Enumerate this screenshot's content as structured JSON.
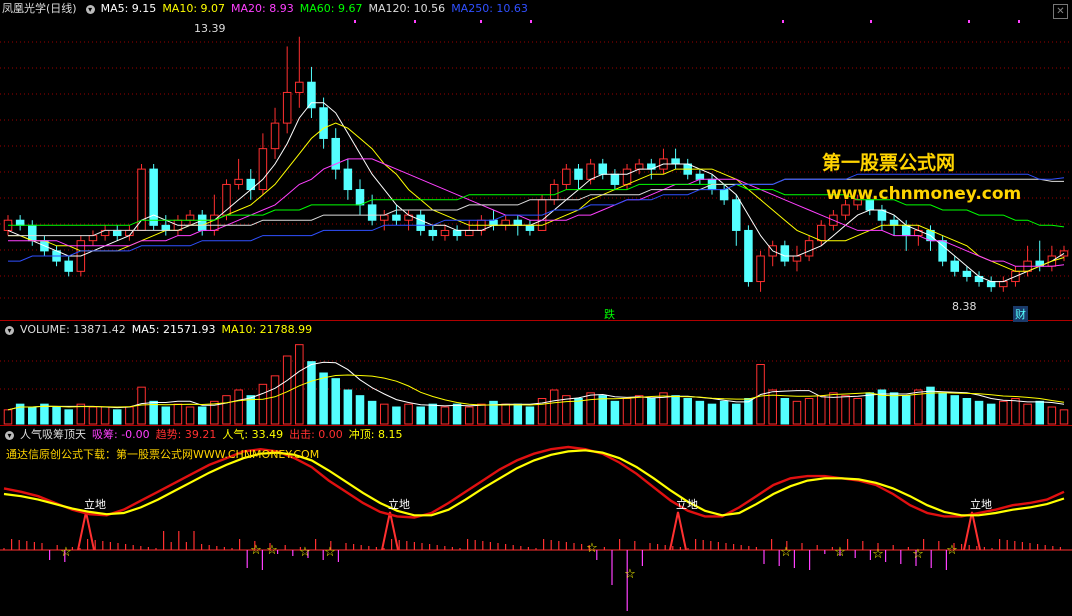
{
  "main": {
    "title": "凤凰光学(日线)",
    "ma": [
      {
        "label": "MA5: 9.15",
        "color": "#ffffff"
      },
      {
        "label": "MA10: 9.07",
        "color": "#ffff00"
      },
      {
        "label": "MA20: 8.93",
        "color": "#ff40ff"
      },
      {
        "label": "MA60: 9.67",
        "color": "#00ff00"
      },
      {
        "label": "MA120: 10.56",
        "color": "#dddddd"
      },
      {
        "label": "MA250: 10.63",
        "color": "#3050ff"
      }
    ],
    "high_label": "13.39",
    "low_label": "8.38",
    "event_die": "跌",
    "event_cai": "财"
  },
  "watermark": {
    "line1": "第一股票公式网",
    "line2": "www.chnmoney.com"
  },
  "volume": {
    "title": "VOLUME: 13871.42",
    "ma5": "MA5: 21571.93",
    "ma10": "MA10: 21788.99"
  },
  "indicator": {
    "title": "人气吸筹顶天",
    "xichou": "吸筹: -0.00",
    "qushi": "趋势: 39.21",
    "renqi": "人气: 33.49",
    "chuji": "出击: 0.00",
    "chongding": "冲顶: 8.15",
    "note": "通达信原创公式下载：第一股票公式网WWW.CHNMONEY.COM",
    "signal": "立地"
  },
  "colors": {
    "up": "#ff3030",
    "down": "#54ffff",
    "grid": "#9a0000"
  },
  "chart_data": {
    "type": "candlestick",
    "title": "凤凰光学(日线)",
    "y_range": [
      8.38,
      13.39
    ],
    "candles": [
      [
        9.6,
        9.8,
        9.9,
        9.5
      ],
      [
        9.8,
        9.7,
        9.9,
        9.6
      ],
      [
        9.7,
        9.4,
        9.8,
        9.3
      ],
      [
        9.4,
        9.2,
        9.5,
        9.1
      ],
      [
        9.2,
        9.0,
        9.3,
        8.9
      ],
      [
        9.0,
        8.8,
        9.1,
        8.7
      ],
      [
        8.8,
        9.4,
        9.5,
        8.7
      ],
      [
        9.4,
        9.5,
        9.6,
        9.3
      ],
      [
        9.5,
        9.6,
        9.7,
        9.4
      ],
      [
        9.6,
        9.5,
        9.7,
        9.4
      ],
      [
        9.5,
        9.6,
        9.7,
        9.4
      ],
      [
        9.6,
        10.8,
        10.9,
        9.6
      ],
      [
        10.8,
        9.7,
        10.9,
        9.6
      ],
      [
        9.7,
        9.6,
        9.9,
        9.5
      ],
      [
        9.6,
        9.8,
        9.9,
        9.5
      ],
      [
        9.8,
        9.9,
        10.0,
        9.7
      ],
      [
        9.9,
        9.6,
        10.0,
        9.5
      ],
      [
        9.6,
        9.9,
        10.3,
        9.5
      ],
      [
        9.9,
        10.5,
        10.6,
        9.8
      ],
      [
        10.5,
        10.6,
        11.0,
        10.4
      ],
      [
        10.6,
        10.4,
        10.8,
        10.2
      ],
      [
        10.4,
        11.2,
        11.5,
        10.3
      ],
      [
        11.2,
        11.7,
        12.0,
        11.0
      ],
      [
        11.7,
        12.3,
        13.2,
        11.5
      ],
      [
        12.3,
        12.5,
        13.39,
        12.0
      ],
      [
        12.5,
        12.0,
        12.8,
        11.8
      ],
      [
        12.0,
        11.4,
        12.2,
        11.2
      ],
      [
        11.4,
        10.8,
        11.6,
        10.6
      ],
      [
        10.8,
        10.4,
        11.0,
        10.2
      ],
      [
        10.4,
        10.1,
        10.6,
        9.9
      ],
      [
        10.1,
        9.8,
        10.3,
        9.7
      ],
      [
        9.8,
        9.9,
        10.0,
        9.6
      ],
      [
        9.9,
        9.8,
        10.1,
        9.7
      ],
      [
        9.8,
        9.9,
        10.0,
        9.6
      ],
      [
        9.9,
        9.6,
        10.0,
        9.5
      ],
      [
        9.6,
        9.5,
        9.7,
        9.4
      ],
      [
        9.5,
        9.6,
        9.7,
        9.4
      ],
      [
        9.6,
        9.5,
        9.7,
        9.4
      ],
      [
        9.5,
        9.6,
        9.8,
        9.5
      ],
      [
        9.6,
        9.8,
        9.9,
        9.5
      ],
      [
        9.8,
        9.7,
        10.0,
        9.6
      ],
      [
        9.7,
        9.8,
        9.9,
        9.6
      ],
      [
        9.8,
        9.7,
        9.9,
        9.5
      ],
      [
        9.7,
        9.6,
        9.8,
        9.5
      ],
      [
        9.6,
        10.2,
        10.3,
        9.6
      ],
      [
        10.2,
        10.5,
        10.6,
        10.1
      ],
      [
        10.5,
        10.8,
        10.9,
        10.4
      ],
      [
        10.8,
        10.6,
        10.9,
        10.4
      ],
      [
        10.6,
        10.9,
        11.0,
        10.5
      ],
      [
        10.9,
        10.7,
        11.0,
        10.6
      ],
      [
        10.7,
        10.5,
        10.8,
        10.4
      ],
      [
        10.5,
        10.8,
        10.9,
        10.4
      ],
      [
        10.8,
        10.9,
        11.0,
        10.7
      ],
      [
        10.9,
        10.8,
        11.0,
        10.6
      ],
      [
        10.8,
        11.0,
        11.2,
        10.7
      ],
      [
        11.0,
        10.9,
        11.2,
        10.8
      ],
      [
        10.9,
        10.7,
        11.0,
        10.6
      ],
      [
        10.7,
        10.6,
        10.8,
        10.5
      ],
      [
        10.6,
        10.4,
        10.7,
        10.3
      ],
      [
        10.4,
        10.2,
        10.5,
        10.1
      ],
      [
        10.2,
        9.6,
        10.3,
        9.3
      ],
      [
        9.6,
        8.6,
        9.7,
        8.5
      ],
      [
        8.6,
        9.1,
        9.2,
        8.4
      ],
      [
        9.1,
        9.3,
        9.4,
        8.9
      ],
      [
        9.3,
        9.0,
        9.4,
        8.9
      ],
      [
        9.0,
        9.1,
        9.3,
        8.8
      ],
      [
        9.1,
        9.4,
        9.5,
        9.0
      ],
      [
        9.4,
        9.7,
        9.8,
        9.3
      ],
      [
        9.7,
        9.9,
        10.0,
        9.6
      ],
      [
        9.9,
        10.1,
        10.2,
        9.8
      ],
      [
        10.1,
        10.2,
        10.3,
        10.0
      ],
      [
        10.2,
        10.0,
        10.3,
        9.9
      ],
      [
        10.0,
        9.8,
        10.1,
        9.6
      ],
      [
        9.8,
        9.7,
        9.9,
        9.5
      ],
      [
        9.7,
        9.5,
        9.8,
        9.2
      ],
      [
        9.5,
        9.6,
        9.7,
        9.3
      ],
      [
        9.6,
        9.4,
        9.7,
        9.2
      ],
      [
        9.4,
        9.0,
        9.5,
        8.9
      ],
      [
        9.0,
        8.8,
        9.1,
        8.7
      ],
      [
        8.8,
        8.7,
        8.9,
        8.6
      ],
      [
        8.7,
        8.6,
        8.8,
        8.5
      ],
      [
        8.6,
        8.5,
        8.7,
        8.4
      ],
      [
        8.5,
        8.6,
        8.7,
        8.4
      ],
      [
        8.6,
        8.8,
        8.9,
        8.5
      ],
      [
        8.8,
        9.0,
        9.3,
        8.7
      ],
      [
        9.0,
        8.9,
        9.4,
        8.8
      ],
      [
        8.9,
        9.1,
        9.3,
        8.8
      ],
      [
        9.1,
        9.2,
        9.3,
        9.0
      ]
    ],
    "volume": [
      5,
      7,
      6,
      7,
      6,
      5,
      7,
      6,
      6,
      5,
      6,
      13,
      8,
      6,
      7,
      6,
      6,
      8,
      10,
      12,
      10,
      14,
      17,
      24,
      28,
      22,
      18,
      16,
      12,
      10,
      8,
      7,
      6,
      7,
      6,
      7,
      6,
      7,
      6,
      7,
      8,
      7,
      7,
      6,
      9,
      12,
      10,
      9,
      11,
      10,
      8,
      9,
      10,
      9,
      11,
      10,
      9,
      8,
      7,
      8,
      7,
      9,
      21,
      12,
      9,
      8,
      9,
      10,
      11,
      10,
      9,
      11,
      12,
      11,
      10,
      12,
      13,
      11,
      10,
      9,
      8,
      7,
      8,
      9,
      7,
      8,
      6,
      5
    ],
    "series": [
      {
        "name": "MA5",
        "values": [
          9.6,
          9.5,
          9.4,
          9.3,
          9.2,
          9.1,
          9.1,
          9.2,
          9.3,
          9.4,
          9.5,
          9.8,
          9.9,
          9.8,
          9.7,
          9.7,
          9.8,
          9.8,
          10.0,
          10.2,
          10.4,
          10.6,
          10.9,
          11.3,
          11.8,
          12.1,
          12.1,
          11.9,
          11.5,
          11.1,
          10.7,
          10.4,
          10.1,
          9.9,
          9.8,
          9.7,
          9.7,
          9.6,
          9.6,
          9.6,
          9.7,
          9.7,
          9.7,
          9.7,
          9.8,
          10.0,
          10.2,
          10.4,
          10.6,
          10.7,
          10.7,
          10.7,
          10.8,
          10.8,
          10.9,
          10.9,
          10.9,
          10.8,
          10.7,
          10.5,
          10.3,
          9.9,
          9.5,
          9.2,
          9.1,
          9.1,
          9.2,
          9.3,
          9.5,
          9.7,
          9.9,
          10.0,
          10.0,
          9.9,
          9.7,
          9.6,
          9.5,
          9.3,
          9.1,
          8.9,
          8.7,
          8.6,
          8.6,
          8.7,
          8.8,
          8.9,
          9.0,
          9.15
        ]
      },
      {
        "name": "MA10",
        "values": [
          9.5,
          9.5,
          9.4,
          9.4,
          9.3,
          9.3,
          9.2,
          9.2,
          9.2,
          9.2,
          9.3,
          9.4,
          9.5,
          9.6,
          9.6,
          9.7,
          9.7,
          9.8,
          9.9,
          10.0,
          10.1,
          10.3,
          10.5,
          10.8,
          11.1,
          11.4,
          11.6,
          11.7,
          11.6,
          11.4,
          11.2,
          10.9,
          10.7,
          10.4,
          10.2,
          10.0,
          9.9,
          9.8,
          9.7,
          9.7,
          9.7,
          9.7,
          9.7,
          9.7,
          9.7,
          9.8,
          9.9,
          10.0,
          10.2,
          10.3,
          10.4,
          10.5,
          10.6,
          10.7,
          10.7,
          10.8,
          10.8,
          10.8,
          10.8,
          10.7,
          10.6,
          10.4,
          10.2,
          10.0,
          9.8,
          9.6,
          9.5,
          9.4,
          9.4,
          9.4,
          9.5,
          9.6,
          9.7,
          9.7,
          9.7,
          9.7,
          9.6,
          9.5,
          9.4,
          9.3,
          9.1,
          9.0,
          8.9,
          8.8,
          8.8,
          8.9,
          9.0,
          9.07
        ]
      },
      {
        "name": "MA20",
        "values": [
          9.4,
          9.4,
          9.4,
          9.4,
          9.4,
          9.3,
          9.3,
          9.3,
          9.3,
          9.3,
          9.3,
          9.4,
          9.4,
          9.4,
          9.5,
          9.5,
          9.6,
          9.6,
          9.7,
          9.8,
          9.9,
          10.0,
          10.1,
          10.3,
          10.5,
          10.6,
          10.8,
          10.9,
          11.0,
          11.0,
          11.0,
          10.9,
          10.8,
          10.7,
          10.6,
          10.5,
          10.4,
          10.3,
          10.2,
          10.1,
          10.0,
          9.9,
          9.9,
          9.8,
          9.8,
          9.8,
          9.8,
          9.9,
          9.9,
          10.0,
          10.1,
          10.2,
          10.2,
          10.3,
          10.4,
          10.5,
          10.5,
          10.6,
          10.6,
          10.6,
          10.6,
          10.5,
          10.4,
          10.3,
          10.2,
          10.1,
          10.0,
          9.9,
          9.8,
          9.7,
          9.6,
          9.6,
          9.6,
          9.5,
          9.5,
          9.5,
          9.4,
          9.4,
          9.3,
          9.2,
          9.1,
          9.0,
          9.0,
          8.9,
          8.9,
          8.9,
          8.9,
          8.93
        ]
      },
      {
        "name": "MA60",
        "values": [
          9.7,
          9.7,
          9.7,
          9.7,
          9.7,
          9.7,
          9.7,
          9.7,
          9.7,
          9.7,
          9.7,
          9.8,
          9.8,
          9.8,
          9.8,
          9.8,
          9.8,
          9.8,
          9.9,
          9.9,
          9.9,
          9.9,
          10.0,
          10.0,
          10.0,
          10.1,
          10.1,
          10.1,
          10.1,
          10.1,
          10.2,
          10.2,
          10.2,
          10.2,
          10.2,
          10.2,
          10.2,
          10.2,
          10.3,
          10.3,
          10.3,
          10.3,
          10.3,
          10.3,
          10.3,
          10.3,
          10.4,
          10.4,
          10.4,
          10.4,
          10.4,
          10.4,
          10.5,
          10.5,
          10.5,
          10.5,
          10.5,
          10.5,
          10.5,
          10.5,
          10.5,
          10.4,
          10.4,
          10.4,
          10.3,
          10.3,
          10.3,
          10.3,
          10.3,
          10.3,
          10.2,
          10.2,
          10.2,
          10.2,
          10.1,
          10.1,
          10.1,
          10.0,
          10.0,
          10.0,
          9.9,
          9.9,
          9.9,
          9.8,
          9.8,
          9.7,
          9.7,
          9.67
        ]
      },
      {
        "name": "MA120",
        "values": [
          9.5,
          9.5,
          9.5,
          9.5,
          9.5,
          9.5,
          9.5,
          9.5,
          9.6,
          9.6,
          9.6,
          9.6,
          9.6,
          9.6,
          9.6,
          9.7,
          9.7,
          9.7,
          9.7,
          9.7,
          9.7,
          9.8,
          9.8,
          9.8,
          9.8,
          9.8,
          9.9,
          9.9,
          9.9,
          9.9,
          9.9,
          9.9,
          10.0,
          10.0,
          10.0,
          10.0,
          10.0,
          10.0,
          10.1,
          10.1,
          10.1,
          10.1,
          10.1,
          10.2,
          10.2,
          10.2,
          10.2,
          10.2,
          10.3,
          10.3,
          10.3,
          10.3,
          10.3,
          10.4,
          10.4,
          10.4,
          10.4,
          10.4,
          10.5,
          10.5,
          10.5,
          10.5,
          10.5,
          10.5,
          10.6,
          10.6,
          10.6,
          10.6,
          10.6,
          10.6,
          10.6,
          10.6,
          10.6,
          10.6,
          10.6,
          10.6,
          10.6,
          10.6,
          10.6,
          10.6,
          10.6,
          10.6,
          10.6,
          10.6,
          10.6,
          10.6,
          10.56,
          10.56
        ]
      },
      {
        "name": "MA250",
        "values": [
          9.0,
          9.0,
          9.1,
          9.1,
          9.1,
          9.1,
          9.2,
          9.2,
          9.2,
          9.2,
          9.2,
          9.3,
          9.3,
          9.3,
          9.3,
          9.3,
          9.4,
          9.4,
          9.4,
          9.4,
          9.4,
          9.5,
          9.5,
          9.5,
          9.5,
          9.5,
          9.6,
          9.6,
          9.6,
          9.6,
          9.6,
          9.7,
          9.7,
          9.7,
          9.7,
          9.7,
          9.8,
          9.8,
          9.8,
          9.8,
          9.8,
          9.9,
          9.9,
          9.9,
          9.9,
          10.0,
          10.0,
          10.0,
          10.1,
          10.1,
          10.1,
          10.2,
          10.2,
          10.2,
          10.3,
          10.3,
          10.3,
          10.4,
          10.4,
          10.4,
          10.5,
          10.5,
          10.5,
          10.5,
          10.6,
          10.6,
          10.6,
          10.6,
          10.6,
          10.6,
          10.7,
          10.7,
          10.7,
          10.7,
          10.7,
          10.7,
          10.7,
          10.7,
          10.7,
          10.7,
          10.7,
          10.7,
          10.7,
          10.7,
          10.7,
          10.6,
          10.6,
          10.63
        ]
      }
    ],
    "indicator_red": [
      0.55,
      0.52,
      0.48,
      0.42,
      0.36,
      0.32,
      0.31,
      0.36,
      0.44,
      0.52,
      0.6,
      0.68,
      0.76,
      0.82,
      0.88,
      0.9,
      0.88,
      0.82,
      0.74,
      0.62,
      0.52,
      0.42,
      0.34,
      0.3,
      0.29,
      0.33,
      0.42,
      0.52,
      0.62,
      0.72,
      0.8,
      0.86,
      0.9,
      0.92,
      0.9,
      0.86,
      0.78,
      0.68,
      0.56,
      0.44,
      0.35,
      0.3,
      0.3,
      0.38,
      0.48,
      0.58,
      0.64,
      0.66,
      0.66,
      0.64,
      0.62,
      0.58,
      0.5,
      0.4,
      0.33,
      0.3,
      0.3,
      0.33,
      0.36,
      0.4,
      0.42,
      0.45,
      0.52
    ],
    "indicator_yellow": [
      0.5,
      0.48,
      0.45,
      0.41,
      0.37,
      0.34,
      0.32,
      0.33,
      0.38,
      0.45,
      0.53,
      0.61,
      0.69,
      0.76,
      0.82,
      0.86,
      0.87,
      0.85,
      0.8,
      0.71,
      0.61,
      0.51,
      0.42,
      0.35,
      0.31,
      0.31,
      0.36,
      0.45,
      0.55,
      0.64,
      0.73,
      0.8,
      0.85,
      0.88,
      0.89,
      0.87,
      0.82,
      0.74,
      0.64,
      0.53,
      0.43,
      0.35,
      0.31,
      0.33,
      0.41,
      0.5,
      0.57,
      0.62,
      0.64,
      0.64,
      0.63,
      0.6,
      0.55,
      0.48,
      0.4,
      0.34,
      0.31,
      0.31,
      0.33,
      0.36,
      0.38,
      0.41,
      0.46
    ]
  }
}
